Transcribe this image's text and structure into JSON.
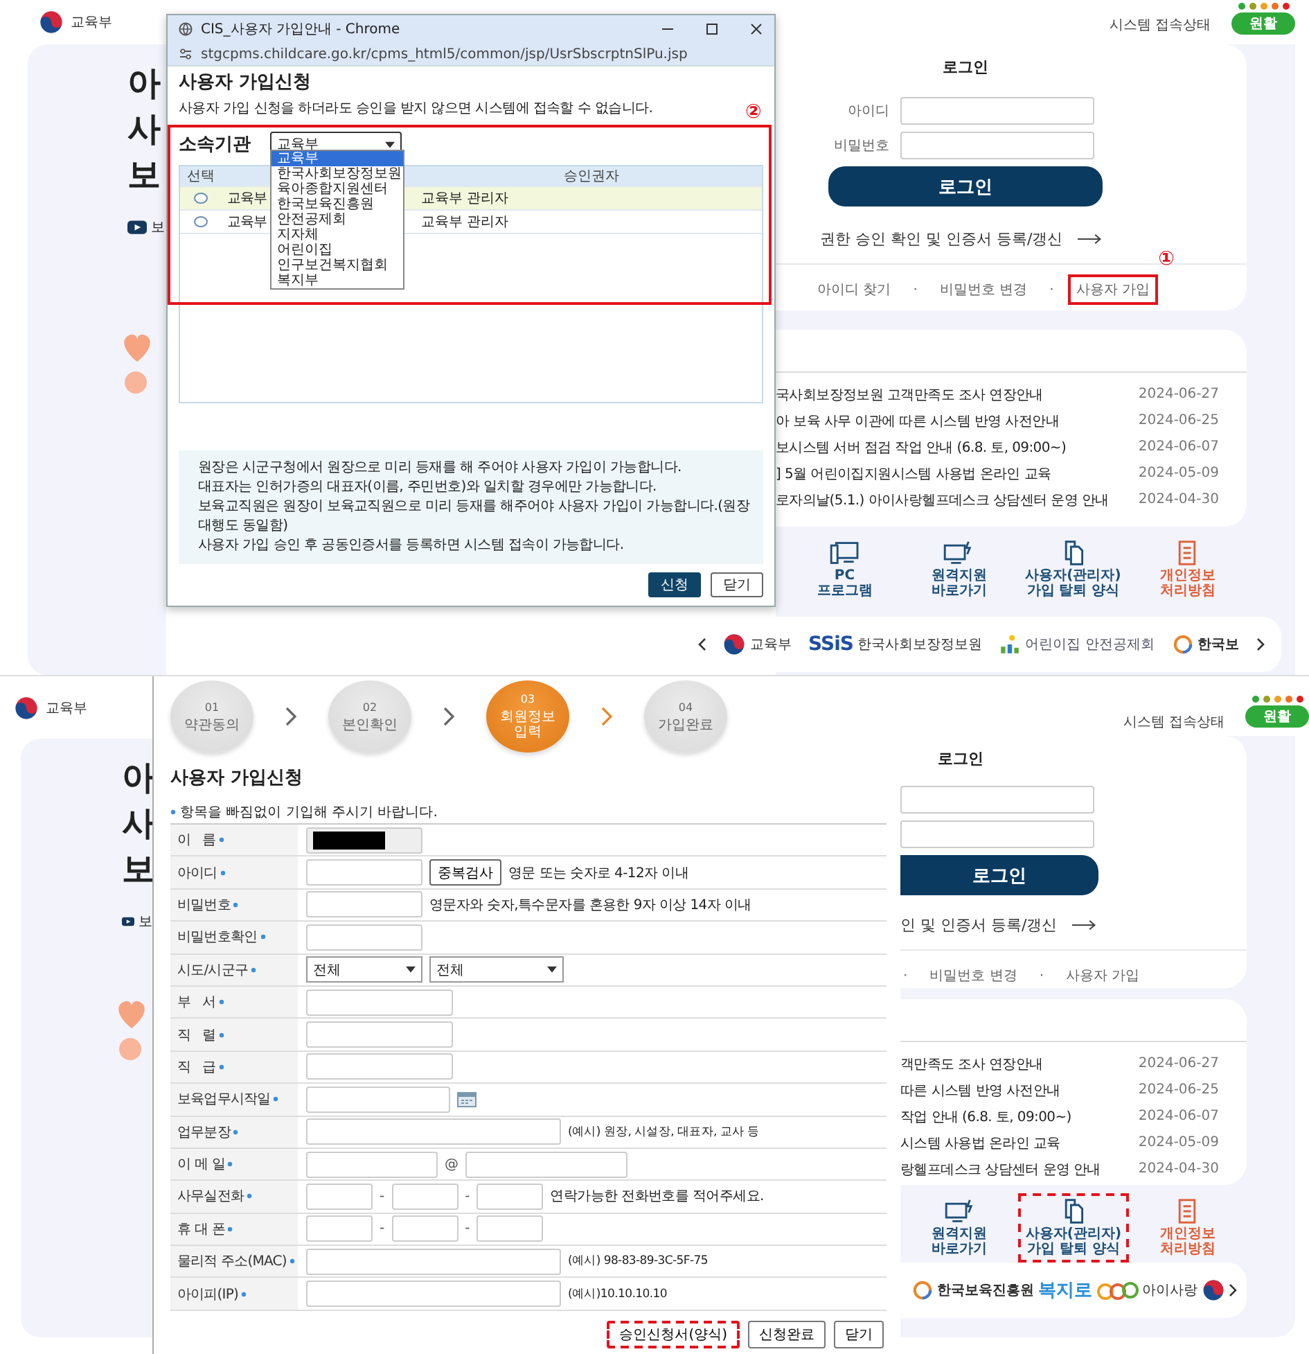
{
  "screens": [
    {
      "kind": "signup_guide",
      "site": {
        "logo_text": "교육부",
        "hero_lines": [
          "아",
          "사",
          "보"
        ],
        "video_link": "보",
        "status_label": "시스템 접속상태",
        "status_dots": [
          {
            "color": "#2eaa3a"
          },
          {
            "color": "#9aa020"
          },
          {
            "color": "#f0a020"
          },
          {
            "color": "#f07020"
          },
          {
            "color": "#e02020"
          }
        ],
        "status_badge": "원활",
        "login": {
          "title": "로그인",
          "id_label": "아이디",
          "password_label": "비밀번호",
          "button": "로그인",
          "cert_link": "권한 승인 확인 및 인증서 등록/갱신",
          "separator": "·",
          "links": [
            {
              "label": "아이디 찾기",
              "separator_before": false,
              "highlighted": false
            },
            {
              "label": "비밀번호 변경",
              "separator_before": true,
              "highlighted": false
            },
            {
              "label": "사용자 가입",
              "separator_before": true,
              "highlighted": true,
              "callout": "①"
            }
          ]
        },
        "notices": [
          {
            "title": "국사회보장정보원 고객만족도 조사 연장안내",
            "date": "2024-06-27"
          },
          {
            "title": "아 보육 사무 이관에 따른 시스템 반영 사전안내",
            "date": "2024-06-25"
          },
          {
            "title": "보시스템 서버 점검 작업 안내 (6.8. 토, 09:00~)",
            "date": "2024-06-07"
          },
          {
            "title": "] 5월 어린이집지원시스템 사용법 온라인 교육",
            "date": "2024-05-09"
          },
          {
            "title": "로자의날(5.1.) 아이사랑헬프데스크 상담센터 운영 안내",
            "date": "2024-04-30"
          }
        ],
        "quick_links": [
          {
            "label": "PC\n프로그램",
            "kind": "pc",
            "highlighted": false
          },
          {
            "label": "원격지원\n바로가기",
            "kind": "remote",
            "highlighted": false
          },
          {
            "label": "사용자(관리자)\n가입 탈퇴 양식",
            "kind": "forms",
            "highlighted": false
          },
          {
            "label": "개인정보\n처리방침",
            "kind": "privacy",
            "highlighted": false
          }
        ],
        "partners": [
          {
            "kind": "prev"
          },
          {
            "kind": "emblem",
            "label": "교육부"
          },
          {
            "kind": "ssis",
            "mark": "SSiS",
            "label": "한국사회보장정보원"
          },
          {
            "kind": "safety",
            "label": "어린이집 안전공제회"
          },
          {
            "kind": "ring",
            "label": "한국보"
          },
          {
            "kind": "next"
          }
        ]
      },
      "popup": {
        "window_title": "CIS_사용자 가입안내 - Chrome",
        "url": "stgcpms.childcare.go.kr/cpms_html5/common/jsp/UsrSbscrptnSlPu.jsp",
        "heading": "사용자 가입신청",
        "notice": "사용자 가입 신청을 하더라도 승인을 받지 않으면 시스템에 접속할 수 없습니다.",
        "callout": "②",
        "org_label": "소속기관",
        "org_value": "교육부",
        "org_options": [
          {
            "label": "교육부",
            "selected": true
          },
          {
            "label": "한국사회보장정보원",
            "selected": false
          },
          {
            "label": "육아종합지원센터",
            "selected": false
          },
          {
            "label": "한국보육진흥원",
            "selected": false
          },
          {
            "label": "안전공제회",
            "selected": false
          },
          {
            "label": "지자체",
            "selected": false
          },
          {
            "label": "어린이집",
            "selected": false
          },
          {
            "label": "인구보건복지협회",
            "selected": false
          },
          {
            "label": "복지부",
            "selected": false
          }
        ],
        "table": {
          "columns": [
            "선택",
            "승인권자"
          ],
          "rows": [
            {
              "selected": true,
              "checked": false,
              "institution": "교육부",
              "approver": "교육부 관리자"
            },
            {
              "selected": false,
              "checked": false,
              "institution": "교육부",
              "approver": "교육부 관리자"
            }
          ]
        },
        "notes": [
          "원장은 시군구청에서 원장으로 미리 등재를 해 주어야 사용자 가입이 가능합니다.",
          "대표자는 인허가증의 대표자(이름, 주민번호)와 일치할 경우에만 가능합니다.",
          "보육교직원은 원장이 보육교직원으로 미리 등재를 해주어야 사용자 가입이 가능합니다.(원장 대행도 동일함)",
          "사용자 가입 승인 후 공동인증서를 등록하면 시스템 접속이 가능합니다."
        ],
        "buttons": [
          {
            "label": "신청",
            "kind": "primary"
          },
          {
            "label": "닫기",
            "kind": "secondary"
          }
        ]
      }
    },
    {
      "kind": "signup_form",
      "site": {
        "logo_text": "교육부",
        "hero_lines": [
          "아",
          "사",
          "보"
        ],
        "video_link": "보",
        "status_label": "시스템 접속상태",
        "status_dots": [
          {
            "color": "#2eaa3a"
          },
          {
            "color": "#9aa020"
          },
          {
            "color": "#f0a020"
          },
          {
            "color": "#f07020"
          },
          {
            "color": "#e02020"
          }
        ],
        "status_badge": "원활",
        "login": {
          "title": "로그인",
          "button": "로그인",
          "cert_link": "인 및 인증서 등록/갱신",
          "separator": "·",
          "links": [
            {
              "label": "비밀번호 변경",
              "separator_before": true,
              "highlighted": false
            },
            {
              "label": "사용자 가입",
              "separator_before": true,
              "highlighted": false
            }
          ]
        },
        "notices": [
          {
            "title": "객만족도 조사 연장안내",
            "date": "2024-06-27"
          },
          {
            "title": "따른 시스템 반영 사전안내",
            "date": "2024-06-25"
          },
          {
            "title": "작업 안내 (6.8. 토, 09:00~)",
            "date": "2024-06-07"
          },
          {
            "title": "시스템 사용법 온라인 교육",
            "date": "2024-05-09"
          },
          {
            "title": "랑헬프데스크 상담센터 운영 안내",
            "date": "2024-04-30"
          }
        ],
        "quick_links": [
          {
            "label": "원격지원\n바로가기",
            "kind": "remote",
            "highlighted": false
          },
          {
            "label": "사용자(관리자)\n가입 탈퇴 양식",
            "kind": "forms",
            "highlighted": true
          },
          {
            "label": "개인정보\n처리방침",
            "kind": "privacy",
            "highlighted": false
          }
        ],
        "partners": [
          {
            "kind": "kcpi",
            "label": "한국보육진흥원"
          },
          {
            "kind": "bokjiro",
            "label": "복지로"
          },
          {
            "kind": "aisarang",
            "label": "아이사랑"
          },
          {
            "kind": "emblem_only"
          },
          {
            "kind": "next"
          }
        ]
      },
      "popup": {
        "steps": [
          {
            "number": "01",
            "label": "약관동의",
            "selected": false
          },
          {
            "number": "02",
            "label": "본인확인",
            "selected": false
          },
          {
            "number": "03",
            "label": "회원정보 입력",
            "selected": true
          },
          {
            "number": "04",
            "label": "가입완료",
            "selected": false
          }
        ],
        "heading": "사용자 가입신청",
        "hint": "항목을 빠짐없이 기입해 주시기 바랍니다.",
        "rows": [
          {
            "label": "이   름",
            "kind": "redacted",
            "required": true
          },
          {
            "label": "아이디",
            "kind": "text_check",
            "required": true,
            "button": "중복검사",
            "help": "영문 또는 숫자로 4-12자 이내"
          },
          {
            "label": "비밀번호",
            "kind": "text",
            "required": true,
            "help": "영문자와 숫자,특수문자를 혼용한 9자 이상 14자 이내"
          },
          {
            "label": "비밀번호확인",
            "kind": "text",
            "required": true
          },
          {
            "label": "시도/시군구",
            "kind": "selects",
            "required": true,
            "options": [
              "전체",
              "전체"
            ]
          },
          {
            "label": "부   서",
            "kind": "medium",
            "required": true
          },
          {
            "label": "직   렬",
            "kind": "medium",
            "required": true
          },
          {
            "label": "직   급",
            "kind": "medium",
            "required": true
          },
          {
            "label": "보육업무시작일",
            "kind": "date",
            "required": true
          },
          {
            "label": "업무분장",
            "kind": "wide",
            "required": true,
            "help": "(예시) 원장, 시설장, 대표자, 교사 등"
          },
          {
            "label": "이 메 일",
            "kind": "email",
            "required": true,
            "at": "@"
          },
          {
            "label": "사무실전화",
            "kind": "phone",
            "required": true,
            "dash": "-",
            "help": "연락가능한 전화번호를 적어주세요."
          },
          {
            "label": "휴 대 폰",
            "kind": "phone",
            "required": true,
            "dash": "-"
          },
          {
            "label": "물리적 주소(MAC)",
            "kind": "wide",
            "required": true,
            "help": "(예시) 98-83-89-3C-5F-75"
          },
          {
            "label": "아이피(IP)",
            "kind": "wide",
            "required": true,
            "help": "(예시)10.10.10.10"
          }
        ],
        "buttons": [
          {
            "label": "승인신청서(양식)",
            "highlighted": true
          },
          {
            "label": "신청완료",
            "highlighted": false
          },
          {
            "label": "닫기",
            "highlighted": false
          }
        ]
      }
    }
  ]
}
